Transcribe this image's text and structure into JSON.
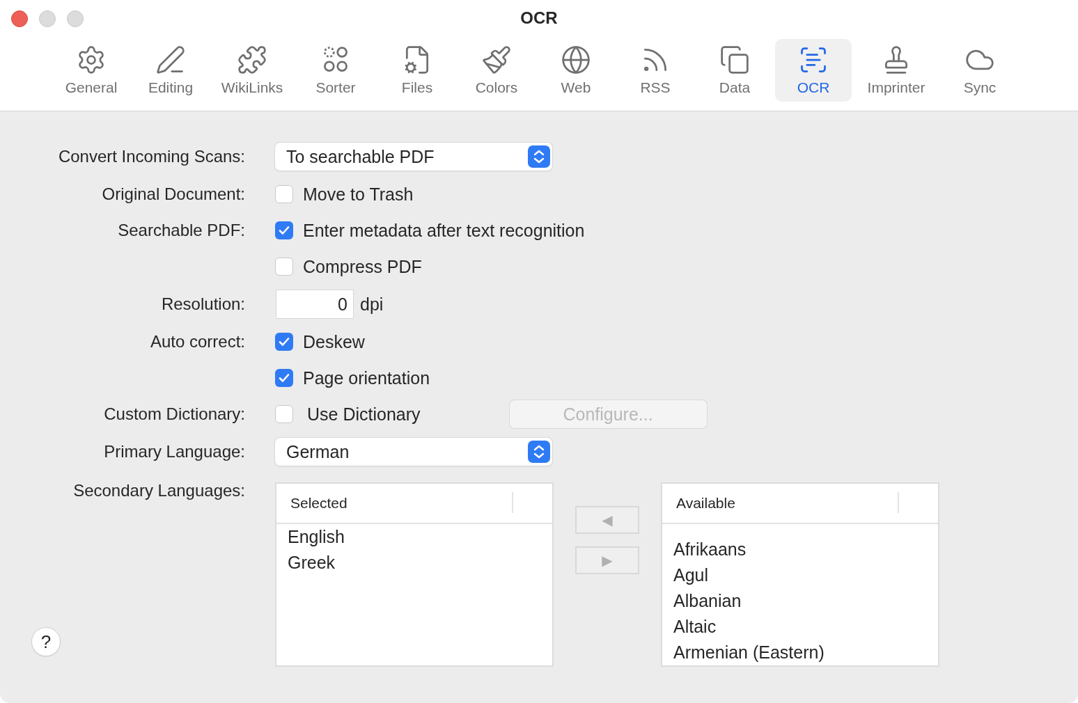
{
  "window": {
    "title": "OCR"
  },
  "toolbar": [
    {
      "label": "General",
      "selected": false
    },
    {
      "label": "Editing",
      "selected": false
    },
    {
      "label": "WikiLinks",
      "selected": false
    },
    {
      "label": "Sorter",
      "selected": false
    },
    {
      "label": "Files",
      "selected": false
    },
    {
      "label": "Colors",
      "selected": false
    },
    {
      "label": "Web",
      "selected": false
    },
    {
      "label": "RSS",
      "selected": false
    },
    {
      "label": "Data",
      "selected": false
    },
    {
      "label": "OCR",
      "selected": true
    },
    {
      "label": "Imprinter",
      "selected": false
    },
    {
      "label": "Sync",
      "selected": false
    }
  ],
  "form": [
    {
      "kind": "select",
      "label": "Convert Incoming Scans:",
      "value": "To searchable PDF"
    },
    {
      "kind": "checkbox",
      "label": "Original Document:",
      "text": "Move to Trash",
      "checked": false
    },
    {
      "kind": "checkbox",
      "label": "Searchable PDF:",
      "text": "Enter metadata after text recognition",
      "checked": true
    },
    {
      "kind": "checkbox",
      "text": "Compress PDF",
      "checked": false
    },
    {
      "kind": "number",
      "label": "Resolution:",
      "value": "0",
      "unit": "dpi"
    },
    {
      "kind": "checkbox",
      "label": "Auto correct:",
      "text": "Deskew",
      "checked": true
    },
    {
      "kind": "checkbox",
      "text": "Page orientation",
      "checked": true
    },
    {
      "kind": "checkbox",
      "label": "Custom Dictionary:",
      "text": "Use Dictionary",
      "checked": false,
      "button": {
        "label": "Configure...",
        "disabled": true
      }
    },
    {
      "kind": "select",
      "label": "Primary Language:",
      "value": "German"
    }
  ],
  "secondary_languages": {
    "label": "Secondary Languages:",
    "selected_list": {
      "header": "Selected",
      "items": [
        "English",
        "Greek"
      ]
    },
    "move_buttons": [
      {
        "label": "◀",
        "disabled": true
      },
      {
        "label": "▶",
        "disabled": true
      }
    ],
    "available_list": {
      "header": "Available",
      "items": [
        "Afrikaans",
        "Agul",
        "Albanian",
        "Altaic",
        "Armenian (Eastern)"
      ]
    }
  },
  "help_button": {
    "label": "?"
  }
}
